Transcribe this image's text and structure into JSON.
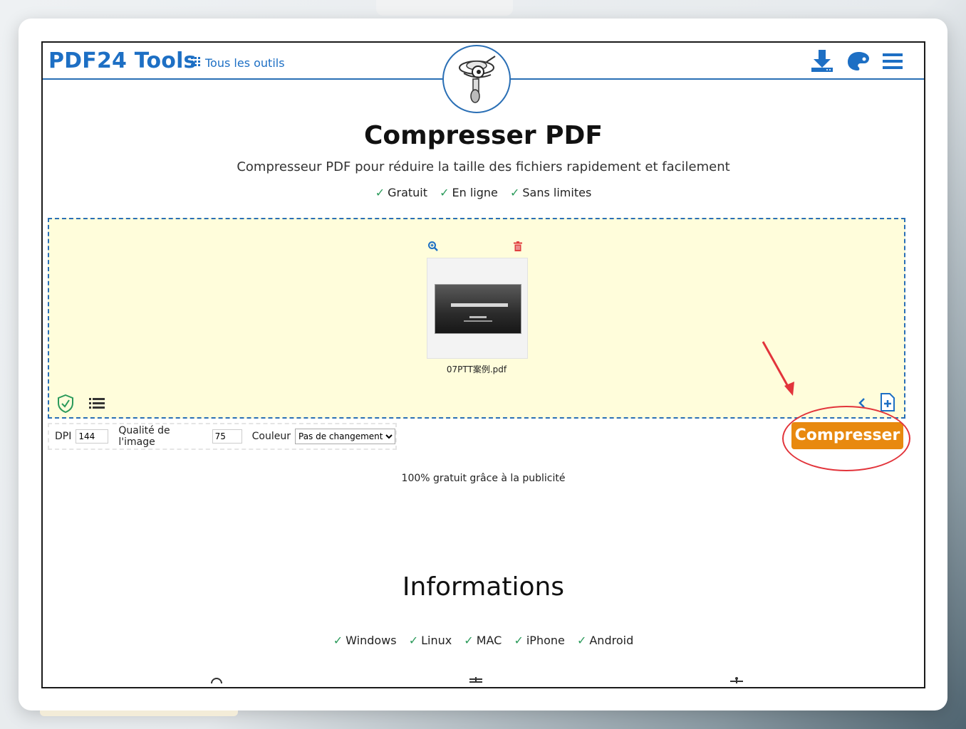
{
  "header": {
    "logo": "PDF24 Tools",
    "tools_link": "Tous les outils",
    "icons": [
      "download-icon",
      "palette-icon",
      "menu-icon"
    ]
  },
  "page": {
    "title": "Compresser PDF",
    "subtitle": "Compresseur PDF pour réduire la taille des fichiers rapidement et facilement",
    "features": [
      "Gratuit",
      "En ligne",
      "Sans limites"
    ]
  },
  "file": {
    "name": "07PTT案例.pdf"
  },
  "options": {
    "dpi_label": "DPI",
    "dpi_value": "144",
    "quality_label": "Qualité de l'image",
    "quality_value": "75",
    "color_label": "Couleur",
    "color_value": "Pas de changement"
  },
  "actions": {
    "compress": "Compresser"
  },
  "footer_note": "100% gratuit grâce à la publicité",
  "info": {
    "title": "Informations",
    "platforms": [
      "Windows",
      "Linux",
      "MAC",
      "iPhone",
      "Android"
    ]
  },
  "colors": {
    "brand": "#1d6fc4",
    "dropzone_bg": "#fffddb",
    "compress_btn": "#e8890f",
    "annotation": "#e2343b",
    "check": "#2a9a5a"
  }
}
